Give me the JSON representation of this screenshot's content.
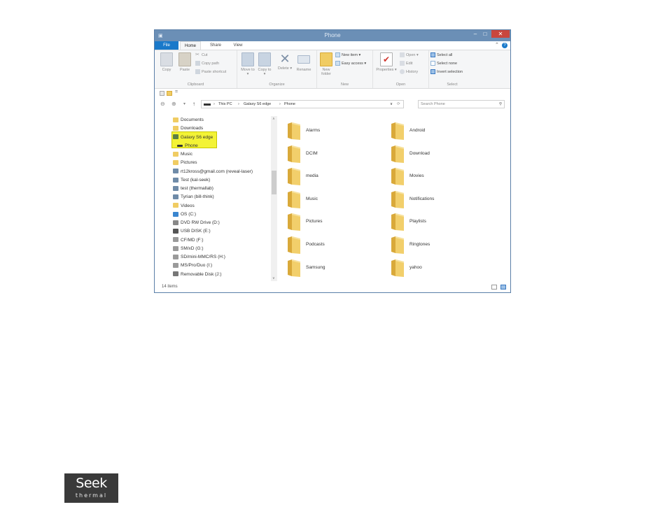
{
  "window": {
    "title": "Phone",
    "minimize_glyph": "–",
    "maximize_glyph": "□",
    "close_glyph": "✕"
  },
  "tabs": {
    "file": "File",
    "home": "Home",
    "share": "Share",
    "view": "View",
    "collapse_glyph": "⌃",
    "help_glyph": "?"
  },
  "ribbon": {
    "clipboard": {
      "copy": "Copy",
      "paste": "Paste",
      "cut": "Cut",
      "copy_path": "Copy path",
      "paste_shortcut": "Paste shortcut",
      "label": "Clipboard"
    },
    "organize": {
      "move_to": "Move to ▾",
      "copy_to": "Copy to ▾",
      "delete": "Delete ▾",
      "rename": "Rename",
      "label": "Organize"
    },
    "new": {
      "new_folder": "New folder",
      "new_item": "New item ▾",
      "easy_access": "Easy access ▾",
      "label": "New"
    },
    "open": {
      "properties": "Properties ▾",
      "open": "Open ▾",
      "edit": "Edit",
      "history": "History",
      "label": "Open"
    },
    "select": {
      "select_all": "Select all",
      "select_none": "Select none",
      "invert_selection": "Invert selection",
      "label": "Select"
    }
  },
  "qat": {
    "dropdown_glyph": "="
  },
  "address": {
    "back": "⊖",
    "forward": "⊕",
    "recent": "▾",
    "up": "↑",
    "path": [
      "This PC",
      "Galaxy S6 edge",
      "Phone"
    ],
    "separator": "›",
    "dropdown": "∨",
    "refresh": "⟳",
    "search_placeholder": "Search Phone",
    "search_icon": "⚲"
  },
  "nav": {
    "items": [
      {
        "label": "Documents",
        "icon": "folder-icon"
      },
      {
        "label": "Downloads",
        "icon": "folder-icon"
      },
      {
        "label": "Galaxy S6 edge",
        "icon": "phone-icon"
      },
      {
        "label": "Phone",
        "icon": "drive-icon"
      },
      {
        "label": "Music",
        "icon": "folder-icon"
      },
      {
        "label": "Pictures",
        "icon": "folder-icon"
      },
      {
        "label": "rt12kross@gmail.com (reveal-laser)",
        "icon": "network-drive-icon"
      },
      {
        "label": "Test (kal-seek)",
        "icon": "network-drive-icon"
      },
      {
        "label": "test (thermallab)",
        "icon": "network-drive-icon"
      },
      {
        "label": "Tyrian (bill-think)",
        "icon": "network-drive-icon"
      },
      {
        "label": "Videos",
        "icon": "folder-icon"
      },
      {
        "label": "OS (C:)",
        "icon": "windows-drive-icon"
      },
      {
        "label": "DVD RW Drive (D:)",
        "icon": "dvd-drive-icon"
      },
      {
        "label": "USB DISK (E:)",
        "icon": "usb-drive-icon"
      },
      {
        "label": "CF/MD (F:)",
        "icon": "card-drive-icon"
      },
      {
        "label": "SM/xD (G:)",
        "icon": "card-drive-icon"
      },
      {
        "label": "SD/mini-MMC/RS (H:)",
        "icon": "card-drive-icon"
      },
      {
        "label": "MS/Pro/Duo (I:)",
        "icon": "card-drive-icon"
      },
      {
        "label": "Removable Disk (J:)",
        "icon": "removable-drive-icon"
      }
    ],
    "scroll_up": "∧",
    "scroll_down": "∨"
  },
  "folders": [
    "Alarms",
    "Android",
    "DCIM",
    "Download",
    "media",
    "Movies",
    "Music",
    "Notifications",
    "Pictures",
    "Playlists",
    "Podcasts",
    "Ringtones",
    "Samsung",
    "yahoo"
  ],
  "status": {
    "count": "14 items"
  },
  "logo": {
    "brand": "Seek",
    "sub": "thermal"
  },
  "colors": {
    "file_tab": "#1979ca",
    "titlebar": "#6b8fb6",
    "highlight": "#f3f336",
    "folder": "#f2cf6b"
  }
}
